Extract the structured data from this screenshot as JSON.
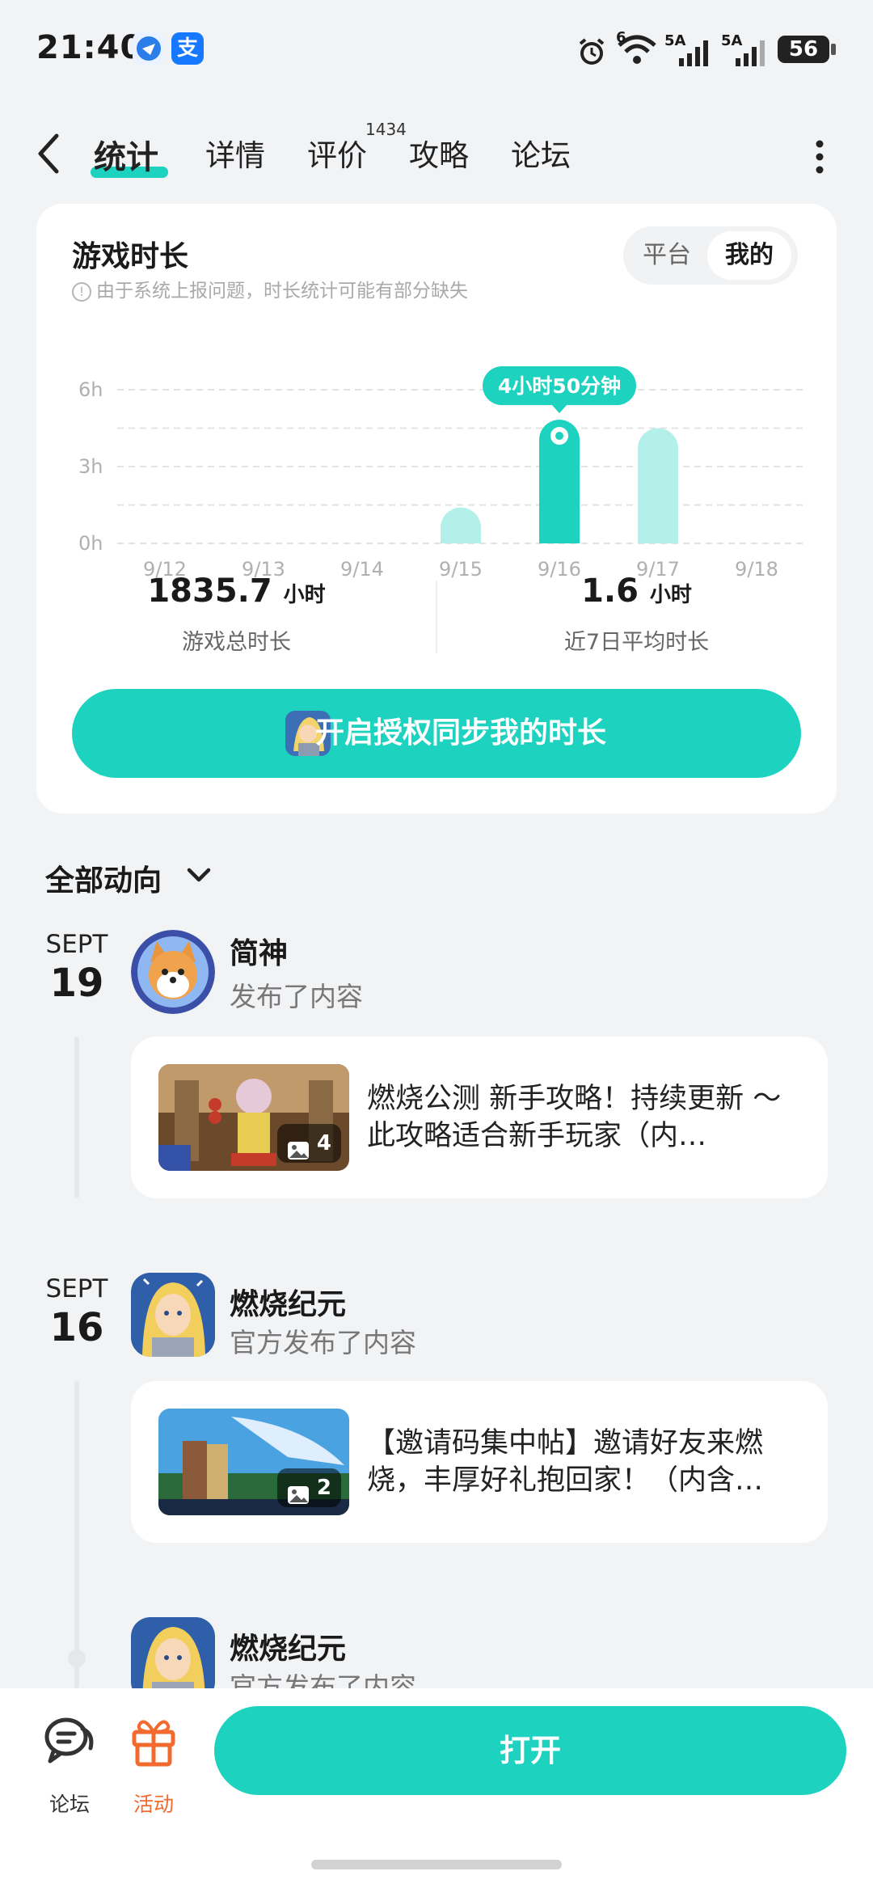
{
  "status_bar": {
    "time": "21:40",
    "battery": "56",
    "signal1": "5A",
    "signal2": "5A",
    "wifi": "6"
  },
  "tabs": {
    "items": [
      {
        "label": "统计"
      },
      {
        "label": "详情"
      },
      {
        "label": "评价"
      },
      {
        "label": "攻略"
      },
      {
        "label": "论坛"
      }
    ],
    "review_count": "1434"
  },
  "stats": {
    "title": "游戏时长",
    "note": "由于系统上报问题，时长统计可能有部分缺失",
    "toggle": {
      "platform": "平台",
      "mine": "我的",
      "selected": "我的"
    },
    "tooltip": "4小时50分钟",
    "summary": {
      "total_value": "1835.7",
      "total_unit": "小时",
      "total_label": "游戏总时长",
      "avg_value": "1.6",
      "avg_unit": "小时",
      "avg_label": "近7日平均时长"
    },
    "sync_button": "开启授权同步我的时长"
  },
  "chart_data": {
    "type": "bar",
    "categories": [
      "9/12",
      "9/13",
      "9/14",
      "9/15",
      "9/16",
      "9/17",
      "9/18"
    ],
    "values": [
      0,
      0,
      0,
      1.4,
      4.83,
      4.5,
      0
    ],
    "highlight_index": 4,
    "y_ticks": [
      "0h",
      "3h",
      "6h"
    ],
    "ylim": [
      0,
      6
    ],
    "colors": {
      "highlight": "#1dd3c0",
      "normal": "#b3f0ea",
      "grid": "#e3e3e3"
    }
  },
  "feed": {
    "filter_label": "全部动向",
    "entries": [
      {
        "month": "SEPT",
        "day": "19",
        "user": "简神",
        "action": "发布了内容",
        "post_text": "燃烧公测 新手攻略！持续更新 ～ 此攻略适合新手玩家（内…",
        "image_count": "4"
      },
      {
        "month": "SEPT",
        "day": "16",
        "user": "燃烧纪元",
        "action": "官方发布了内容",
        "post_text": "【邀请码集中帖】邀请好友来燃烧，丰厚好礼抱回家！（内含…",
        "image_count": "2"
      },
      {
        "user": "燃烧纪元",
        "action": "官方发布了内容"
      }
    ]
  },
  "bottom_bar": {
    "forum_label": "论坛",
    "activity_label": "活动",
    "open_label": "打开"
  }
}
